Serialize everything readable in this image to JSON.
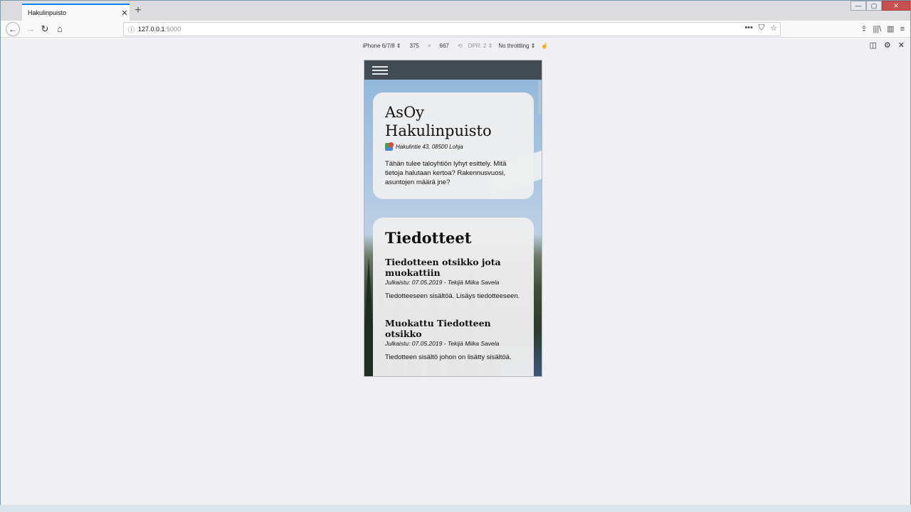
{
  "browser": {
    "tab_title": "Hakulinpuisto",
    "tab_close": "✕",
    "new_tab": "+",
    "window_controls": {
      "minimize": "—",
      "maximize": "▢",
      "close": "✕"
    },
    "url_host": "127.0.0.1",
    "url_port": ":5000",
    "url_actions": [
      "•••",
      "⛉",
      "☆"
    ],
    "toolbar_icons": [
      "⇪",
      "|||\\",
      "▥",
      "≡"
    ]
  },
  "rdm": {
    "device": "iPhone 6/7/8 ⇕",
    "width": "375",
    "times": "×",
    "height": "667",
    "rotate_icon": "⟲",
    "dpr": "DPR: 2 ⇕",
    "throttling": "No throttling ⇕",
    "touch_icon": "☝",
    "right_icons": [
      "◫",
      "⚙",
      "✕"
    ]
  },
  "page": {
    "site_title": "AsOy Hakulinpuisto",
    "address": "Hakulintie 43, 08500 Lohja",
    "intro": "Tähän tulee taloyhtiön lyhyt esittely. Mitä tietoja halutaan kertoa? Rakennusvuosi, asuntojen määrä jne?",
    "announcements_title": "Tiedotteet",
    "announcements": [
      {
        "title": "Tiedotteen otsikko jota muokattiin",
        "meta": "Julkaistu: 07.05.2019 - Tekijä Miika Savela",
        "body": "Tiedotteeseen sisältöä. Lisäys tiedotteeseen."
      },
      {
        "title": "Muokattu Tiedotteen otsikko",
        "meta": "Julkaistu: 07.05.2019 - Tekijä Miika Savela",
        "body": "Tiedotteen sisältö johon on lisätty sisältöä."
      }
    ]
  }
}
